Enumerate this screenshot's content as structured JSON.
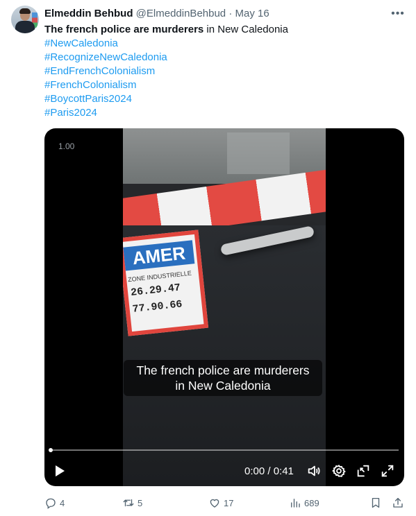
{
  "author": {
    "name": "Elmeddin Behbud",
    "handle": "@ElmeddinBehbud",
    "separator": "·",
    "date": "May 16"
  },
  "tweet": {
    "bold_text": "The french police are murderers",
    "text_rest": " in New Caledonia",
    "hashtags": [
      "#NewCaledonia",
      "#RecognizeNewCaledonia",
      "#EndFrenchColonialism",
      "#FrenchColonialism",
      "#BoycottParis2024",
      "#Paris2024"
    ]
  },
  "video": {
    "playback_rate": "1.00",
    "caption_line1": "The french police are murderers",
    "caption_line2": "in New Caledonia",
    "time_display": "0:00 / 0:41",
    "progress": 0.0,
    "sticker_logo": "AMER",
    "sticker_line1": "ZONE INDUSTRIELLE",
    "sticker_line2": "26.29.47",
    "sticker_line3": "77.90.66"
  },
  "actions": {
    "replies": "4",
    "reposts": "5",
    "likes": "17",
    "views": "689"
  },
  "colors": {
    "text": "#0f1419",
    "muted": "#536471",
    "link": "#1d9bf0"
  }
}
